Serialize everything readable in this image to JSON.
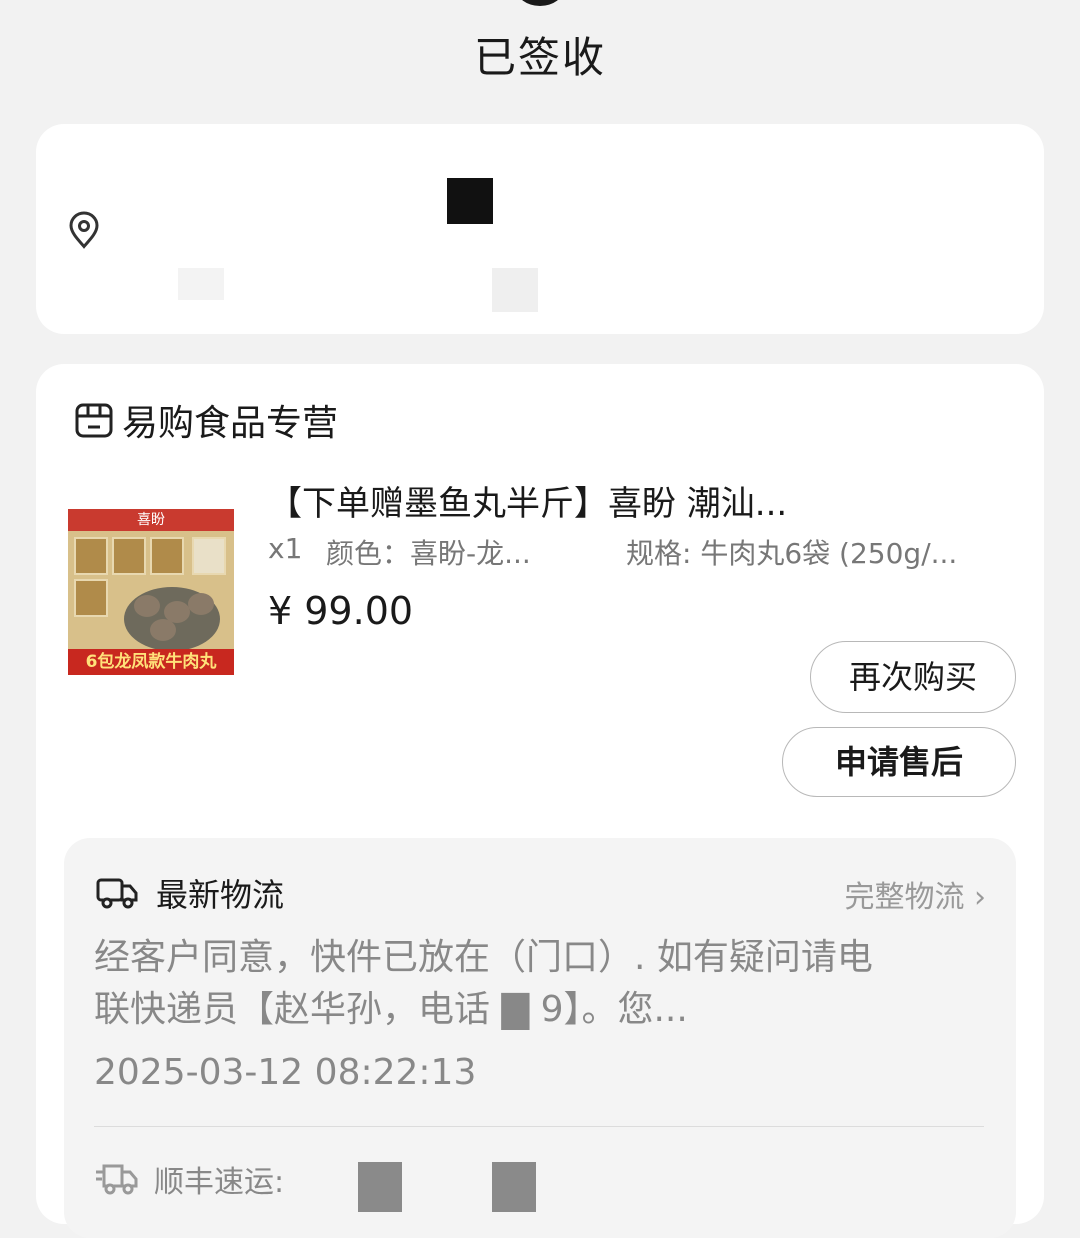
{
  "header": {
    "title": "已签收"
  },
  "address": {
    "icon": "location-pin-icon"
  },
  "store": {
    "icon": "store-icon",
    "name": "易购食品专营"
  },
  "product": {
    "title": "【下单赠墨鱼丸半斤】喜盼 潮汕...",
    "quantity": "x1",
    "color": "颜色：喜盼-龙...",
    "spec": "规格: 牛肉丸6袋 (250g/...",
    "price": "¥ 99.00",
    "image": {
      "brand": "喜盼",
      "banner": "6包龙凤款牛肉丸"
    }
  },
  "actions": {
    "buy_again": "再次购买",
    "after_sale": "申请售后"
  },
  "logistics": {
    "icon": "truck-icon",
    "title": "最新物流",
    "full_link": "完整物流 ›",
    "line1": "经客户同意，快件已放在（门口）. 如有疑问请电",
    "line2": "联快递员【赵华孙，电话 ▇               9】。您...",
    "time": "2025-03-12 08:22:13",
    "carrier_icon": "delivery-truck-icon",
    "carrier": "顺丰速运:"
  },
  "colors": {
    "background": "#f2f2f2",
    "card": "#ffffff",
    "text": "#1a1a1a",
    "muted": "#888888",
    "redaction": "#111111"
  }
}
